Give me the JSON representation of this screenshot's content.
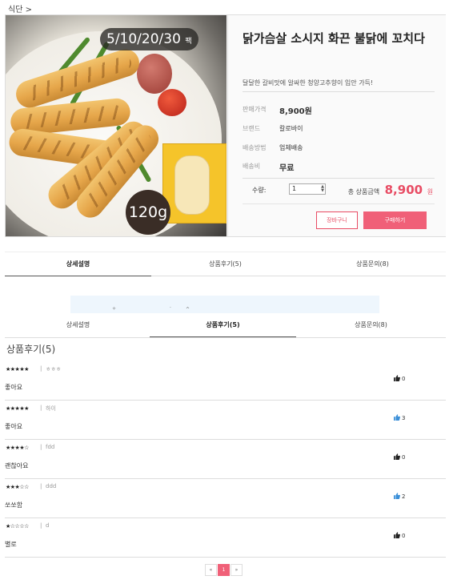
{
  "breadcrumb": "식단 >",
  "product": {
    "size_options": "5/10/20/30",
    "size_unit": "팩",
    "weight": "120g",
    "title": "닭가슴살 소시지 화끈 불닭에 꼬치다",
    "description": "달달한 갈비맛에 알싸한 청양고추향이 입안 가득!",
    "fields": [
      {
        "label": "판매가격",
        "value": "8,900원"
      },
      {
        "label": "브랜드",
        "value": "칼로바이"
      },
      {
        "label": "배송방법",
        "value": "업체배송"
      },
      {
        "label": "배송비",
        "value": "무료"
      }
    ],
    "quantity_label": "수량:",
    "quantity_value": "1",
    "total_label": "총 상품금액",
    "total_amount": "8,900",
    "total_unit": "원",
    "cart_button": "장바구니",
    "buy_button": "구매하기"
  },
  "tabs_top": [
    "상세설명",
    "상품후기(5)",
    "상품문의(8)"
  ],
  "tabs_review": [
    "상세설명",
    "상품후기(5)",
    "상품문의(8)"
  ],
  "review_section_title": "상품후기(5)",
  "reviews": [
    {
      "stars": "★★★★★",
      "author": "ㅎㅎㅎ",
      "text": "좋아요",
      "likes": "0",
      "liked": false
    },
    {
      "stars": "★★★★★",
      "author": "하이",
      "text": "좋아요",
      "likes": "3",
      "liked": true
    },
    {
      "stars": "★★★★☆",
      "author": "fdd",
      "text": "괜찮아요",
      "likes": "0",
      "liked": false
    },
    {
      "stars": "★★★☆☆",
      "author": "ddd",
      "text": "쏘쏘함",
      "likes": "2",
      "liked": true
    },
    {
      "stars": "★☆☆☆☆",
      "author": "d",
      "text": "별로",
      "likes": "0",
      "liked": false
    }
  ],
  "pagination": {
    "prev": "«",
    "current": "1",
    "next": "»"
  },
  "colors": {
    "accent": "#f06078",
    "price": "#e84c64",
    "like_active": "#3a8fd8",
    "like_inactive": "#222222"
  }
}
